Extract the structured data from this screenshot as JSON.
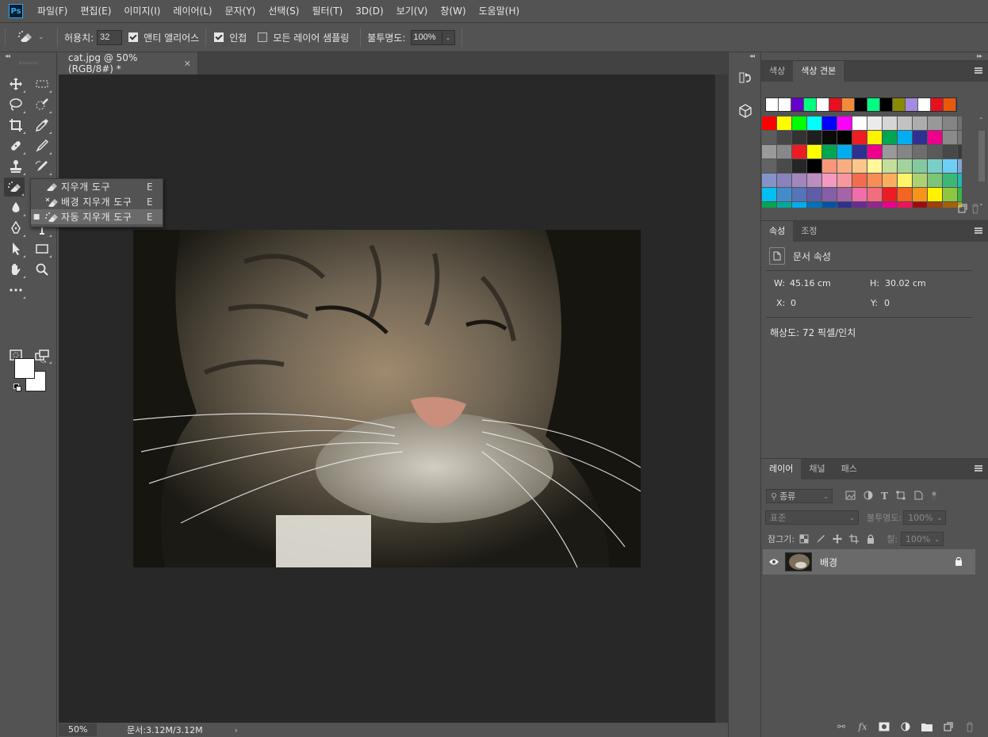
{
  "menubar": {
    "logo": "Ps",
    "items": [
      "파일(F)",
      "편집(E)",
      "이미지(I)",
      "레이어(L)",
      "문자(Y)",
      "선택(S)",
      "필터(T)",
      "3D(D)",
      "보기(V)",
      "창(W)",
      "도움말(H)"
    ]
  },
  "options": {
    "tolerance_label": "허용치:",
    "tolerance_value": "32",
    "antialias_label": "앤티 앨리어스",
    "antialias_checked": true,
    "contiguous_label": "인접",
    "contiguous_checked": true,
    "all_layers_label": "모든 레이어 샘플링",
    "all_layers_checked": false,
    "opacity_label": "불투명도:",
    "opacity_value": "100%"
  },
  "document": {
    "tab_title": "cat.jpg @ 50% (RGB/8#) *",
    "zoom": "50%",
    "doc_info": "문서:3.12M/3.12M"
  },
  "flyout": {
    "items": [
      {
        "label": "지우개 도구",
        "key": "E",
        "icon": "eraser-icon",
        "selected": false
      },
      {
        "label": "배경 지우개 도구",
        "key": "E",
        "icon": "background-eraser-icon",
        "selected": false
      },
      {
        "label": "자동 지우개 도구",
        "key": "E",
        "icon": "magic-eraser-icon",
        "selected": true
      }
    ]
  },
  "swatches_panel": {
    "tabs": [
      "색상",
      "색상 견본"
    ],
    "active_tab": "색상 견본",
    "recent": [
      "#ffffff",
      "#ffffff",
      "#6600cc",
      "#00ff80",
      "#ffffff",
      "#e8101f",
      "#f28a3c",
      "#000000",
      "#00ff80",
      "#000000",
      "#8a8a00",
      "#a48ae0",
      "#ffffff",
      "#e8101f",
      "#e85a0a"
    ],
    "grid": [
      "#ff0000",
      "#ffff00",
      "#00ff00",
      "#00ffff",
      "#0000ff",
      "#ff00ff",
      "#ffffff",
      "#ebebeb",
      "#d6d6d6",
      "#c2c2c2",
      "#adadad",
      "#999999",
      "#858585",
      "#707070",
      "#5c5c5c",
      "#474747",
      "#333333",
      "#1f1f1f",
      "#0a0a0a",
      "#000000",
      "#ee1c24",
      "#fff200",
      "#00a650",
      "#00aeef",
      "#2e3192",
      "#ec008c",
      "#8a8a8a",
      "#777777",
      "#9a9a9a",
      "#888888",
      "#ec1c24",
      "#ffff00",
      "#00a651",
      "#00aeef",
      "#2e3192",
      "#ec008c",
      "#999999",
      "#858585",
      "#6e6e6e",
      "#5a5a5a",
      "#484848",
      "#3a3a3a",
      "#636363",
      "#4a4a4a",
      "#262626",
      "#000000",
      "#f7977a",
      "#f9ad81",
      "#fdc68a",
      "#fff79a",
      "#c4df9b",
      "#a3d39c",
      "#82ca9d",
      "#7bcdc8",
      "#6ecff6",
      "#7ea7d8",
      "#8493ca",
      "#8882be",
      "#a187be",
      "#bc8dbf",
      "#f49ac2",
      "#f6989d",
      "#f26c4f",
      "#f68e55",
      "#fbaf5c",
      "#fff467",
      "#acd372",
      "#7cc576",
      "#3bb878",
      "#1abbb4",
      "#00bff3",
      "#438ccb",
      "#5574b9",
      "#605ca8",
      "#855fa8",
      "#a763a8",
      "#f06ea9",
      "#f26d7d",
      "#ed1c24",
      "#f26522",
      "#f7941d",
      "#fff200",
      "#8dc73f",
      "#39b54a",
      "#00a651",
      "#00a99d",
      "#00aeef",
      "#0072bc",
      "#0054a6",
      "#2e3192",
      "#662d91",
      "#92278f",
      "#ec008c",
      "#ed145b",
      "#9e0b0f",
      "#a0410d",
      "#a36209",
      "#aba000"
    ]
  },
  "properties_panel": {
    "tabs": [
      "속성",
      "조정"
    ],
    "title": "문서 속성",
    "w_label": "W:",
    "w_value": "45.16 cm",
    "h_label": "H:",
    "h_value": "30.02 cm",
    "x_label": "X:",
    "x_value": "0",
    "y_label": "Y:",
    "y_value": "0",
    "resolution": "해상도: 72 픽셀/인치"
  },
  "layers_panel": {
    "tabs": [
      "레이어",
      "채널",
      "패스"
    ],
    "filter_placeholder": "종류",
    "blend_mode": "표준",
    "opacity_label": "불투명도:",
    "opacity_value": "100%",
    "lock_label": "잠그기:",
    "fill_label": "칠:",
    "fill_value": "100%",
    "layers": [
      {
        "name": "배경",
        "visible": true,
        "locked": true
      }
    ],
    "footer_fx": "fx"
  }
}
